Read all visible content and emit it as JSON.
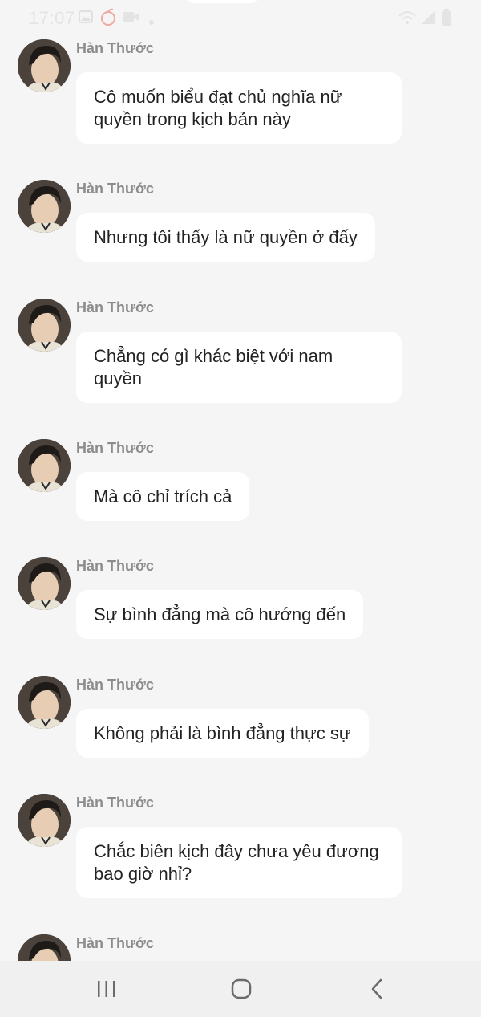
{
  "status_bar": {
    "time": "17:07",
    "icons": [
      "gallery-icon",
      "fruit-icon",
      "video-icon",
      "dot-icon",
      "wifi-icon",
      "signal-icon",
      "battery-icon"
    ]
  },
  "chat": {
    "messages": [
      {
        "sender": "Hàn Thước",
        "text": "Cô muốn biểu đạt chủ nghĩa nữ quyền trong kịch bản này"
      },
      {
        "sender": "Hàn Thước",
        "text": "Nhưng tôi thấy là nữ quyền ở đấy"
      },
      {
        "sender": "Hàn Thước",
        "text": "Chẳng có gì khác biệt với nam quyền"
      },
      {
        "sender": "Hàn Thước",
        "text": "Mà cô chỉ trích cả"
      },
      {
        "sender": "Hàn Thước",
        "text": "Sự bình đẳng mà cô hướng đến"
      },
      {
        "sender": "Hàn Thước",
        "text": "Không phải là bình đẳng thực sự"
      },
      {
        "sender": "Hàn Thước",
        "text": "Chắc biên kịch đây chưa yêu đương bao giờ nhỉ?"
      },
      {
        "sender": "Hàn Thước",
        "text": ""
      }
    ]
  },
  "nav_bar": {
    "buttons": [
      "recent-apps-icon",
      "home-icon",
      "back-icon"
    ]
  },
  "colors": {
    "background": "#f5f5f5",
    "bubble": "#ffffff",
    "sender_name": "#8c8c8c",
    "message_text": "#222222"
  }
}
